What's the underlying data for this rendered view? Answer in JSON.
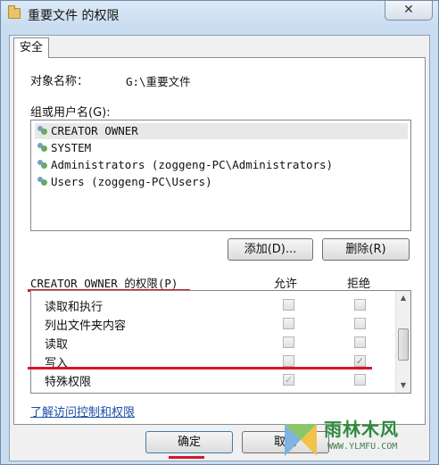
{
  "window": {
    "title": "重要文件 的权限",
    "close_label": "✕"
  },
  "tab": {
    "label": "安全"
  },
  "object": {
    "label": "对象名称：",
    "value": "G:\\重要文件"
  },
  "groups": {
    "label": "组或用户名(G):",
    "items": [
      {
        "name": "CREATOR OWNER",
        "selected": true
      },
      {
        "name": "SYSTEM",
        "selected": false
      },
      {
        "name": "Administrators (zoggeng-PC\\Administrators)",
        "selected": false
      },
      {
        "name": "Users (zoggeng-PC\\Users)",
        "selected": false
      }
    ]
  },
  "buttons": {
    "add": "添加(D)...",
    "remove": "删除(R)",
    "ok": "确定",
    "cancel": "取消"
  },
  "permissions": {
    "label": "CREATOR OWNER 的权限(P)",
    "allow_header": "允许",
    "deny_header": "拒绝",
    "rows": [
      {
        "name": "读取和执行",
        "allow": false,
        "deny": false
      },
      {
        "name": "列出文件夹内容",
        "allow": false,
        "deny": false
      },
      {
        "name": "读取",
        "allow": false,
        "deny": false
      },
      {
        "name": "写入",
        "allow": false,
        "deny": true
      },
      {
        "name": "特殊权限",
        "allow": true,
        "deny": false
      }
    ]
  },
  "link": {
    "label": "了解访问控制和权限"
  },
  "watermark": {
    "brand": "雨林木风",
    "url": "WWW.YLMFU.COM"
  },
  "colors": {
    "highlight": "#d4172a",
    "link": "#1a4ea8",
    "frame": "#c9dcf0"
  },
  "icons": {
    "folder": "folder-icon",
    "user": "user-group-icon",
    "check": "check-icon"
  }
}
